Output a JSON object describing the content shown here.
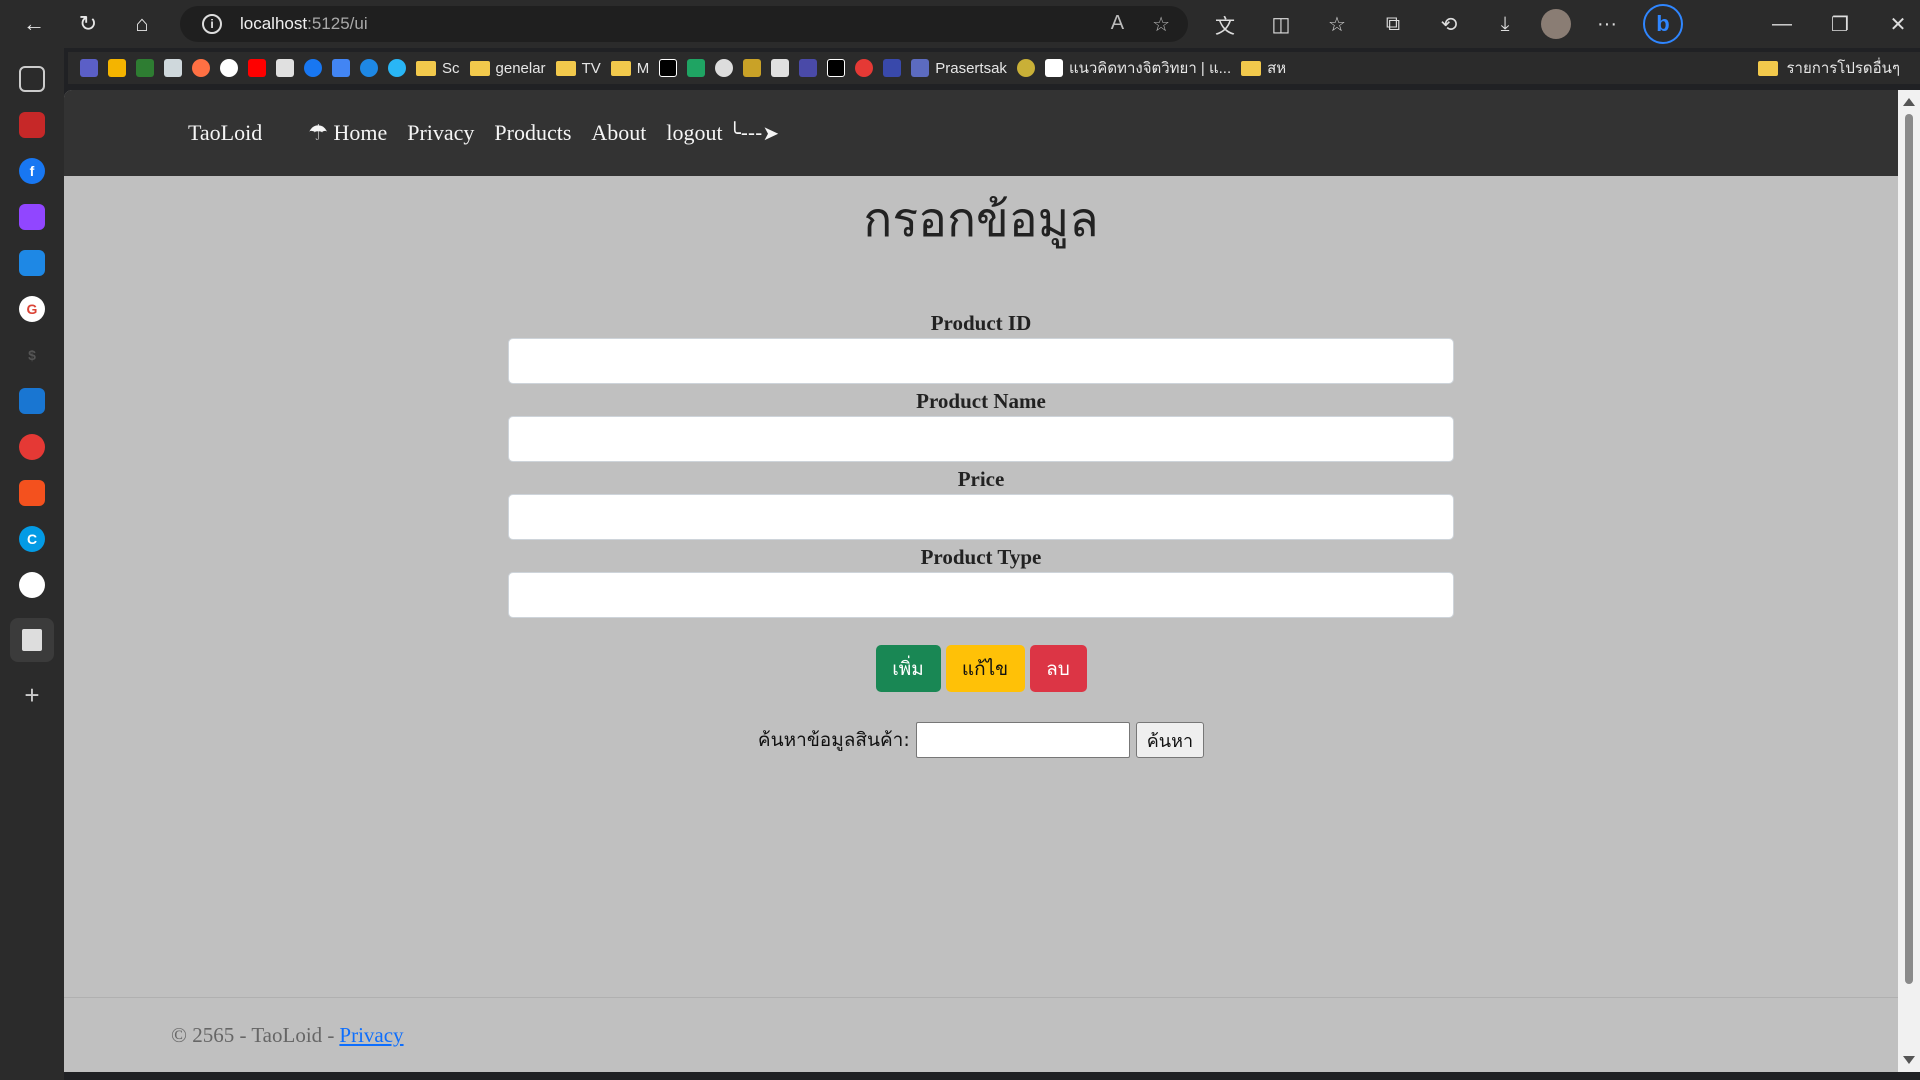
{
  "browser": {
    "url_host": "localhost",
    "url_path": ":5125/ui",
    "bookmarks": [
      {
        "label": "",
        "color": "#5b5fc7"
      },
      {
        "label": "",
        "color": "#f4b400"
      },
      {
        "label": "",
        "color": "#2e7d32"
      },
      {
        "label": "",
        "color": "#cfd8dc"
      },
      {
        "label": "",
        "color": "#ff7043"
      },
      {
        "label": "",
        "color": "#ffffff"
      },
      {
        "label": "",
        "color": "#ff0000"
      },
      {
        "label": "",
        "color": "#e0e0e0"
      },
      {
        "label": "",
        "color": "#1877f2"
      },
      {
        "label": "",
        "color": "#4285f4"
      },
      {
        "label": "",
        "color": "#1e88e5"
      },
      {
        "label": "",
        "color": "#29b6f6"
      }
    ],
    "bookmark_sc": "Sc",
    "bookmark_genelar": "genelar",
    "bookmark_tv": "TV",
    "bookmark_m": "M",
    "bookmark_prasertsak": "Prasertsak",
    "bookmark_thai": "แนวคิดทางจิตวิทยา | แ...",
    "bookmark_sh": "สห",
    "bookmark_other": "รายการโปรดอื่นๆ"
  },
  "nav": {
    "brand": "TaoLoid",
    "home_icon": "☂",
    "home": "Home",
    "privacy": "Privacy",
    "products": "Products",
    "about": "About",
    "logout": "logout",
    "logout_icon": "╰---➤"
  },
  "page": {
    "title": "กรอกข้อมูล",
    "fields": {
      "product_id": "Product ID",
      "product_name": "Product Name",
      "price": "Price",
      "product_type": "Product Type"
    },
    "buttons": {
      "add": "เพิ่ม",
      "edit": "แก้ไข",
      "delete": "ลบ"
    },
    "search_label": "ค้นหาข้อมูลสินค้า:",
    "search_button": "ค้นหา"
  },
  "footer": {
    "text": "© 2565 - TaoLoid -",
    "link": "Privacy"
  }
}
